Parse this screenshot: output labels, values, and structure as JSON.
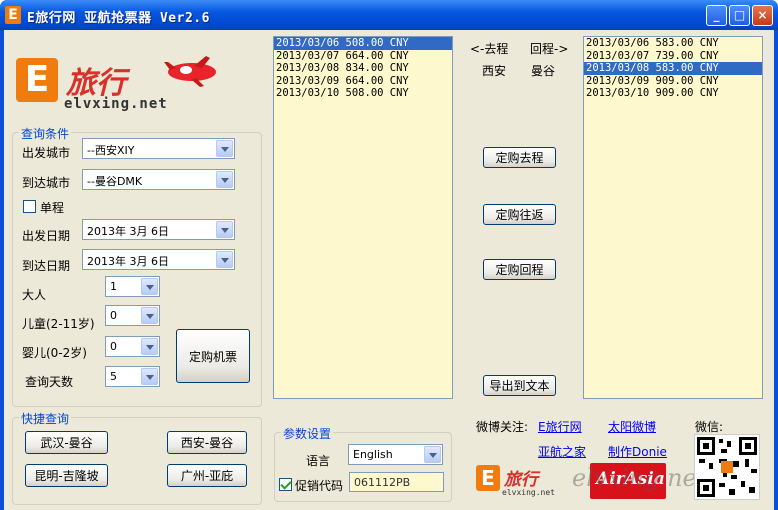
{
  "window": {
    "title": "E旅行网 亚航抢票器 Ver2.6",
    "icon_letter": "E",
    "controls": {
      "minimize": "_",
      "maximize": "□",
      "close": "×"
    }
  },
  "logo": {
    "text": "旅行",
    "letter": "E",
    "url_text": "elvxing.net"
  },
  "query": {
    "legend": "查询条件",
    "depart_city_label": "出发城市",
    "depart_city_value": "--西安XIY",
    "arrive_city_label": "到达城市",
    "arrive_city_value": "--曼谷DMK",
    "oneway_label": "单程",
    "oneway_checked": false,
    "depart_date_label": "出发日期",
    "depart_date_value": "2013年 3月 6日",
    "return_date_label": "到达日期",
    "return_date_value": "2013年 3月 6日",
    "adult_label": "大人",
    "adult_value": "1",
    "child_label": "儿童(2-11岁)",
    "child_value": "0",
    "infant_label": "婴儿(0-2岁)",
    "infant_value": "0",
    "days_label": "查询天数",
    "days_value": "5",
    "book_button": "定购机票"
  },
  "quick": {
    "legend": "快捷查询",
    "routes": [
      "武汉-曼谷",
      "西安-曼谷",
      "昆明-吉隆坡",
      "广州-亚庇"
    ]
  },
  "outbound": {
    "items": [
      "2013/03/06 508.00 CNY",
      "2013/03/07 664.00 CNY",
      "2013/03/08 834.00 CNY",
      "2013/03/09 664.00 CNY",
      "2013/03/10 508.00 CNY"
    ],
    "selected_index": 0
  },
  "inbound": {
    "items": [
      "2013/03/06 583.00 CNY",
      "2013/03/07 739.00 CNY",
      "2013/03/08 583.00 CNY",
      "2013/03/09 909.00 CNY",
      "2013/03/10 909.00 CNY"
    ],
    "selected_index": 2
  },
  "middle": {
    "out_label": "<-去程",
    "back_label": "回程->",
    "from_city": "西安",
    "to_city": "曼谷",
    "book_out": "定购去程",
    "book_round": "定购往返",
    "book_back": "定购回程",
    "export": "导出到文本"
  },
  "params": {
    "legend": "参数设置",
    "language_label": "语言",
    "language_value": "English",
    "promo_label": "促销代码",
    "promo_checked": true,
    "promo_value": "061112PB"
  },
  "footer": {
    "weibo_label": "微博关注:",
    "links": [
      "E旅行网",
      "太阳微博",
      "亚航之家",
      "制作Donie"
    ],
    "wechat_label": "微信:",
    "airasia_text": "AirAsia",
    "watermark": "elvxing.net"
  },
  "colors": {
    "titlebar": "#0757e0",
    "client_bg": "#ece9d8",
    "listbox_bg": "#fdf8cd",
    "selection": "#316ac5",
    "brand_orange": "#f07c10",
    "airasia_red": "#d8121a"
  }
}
